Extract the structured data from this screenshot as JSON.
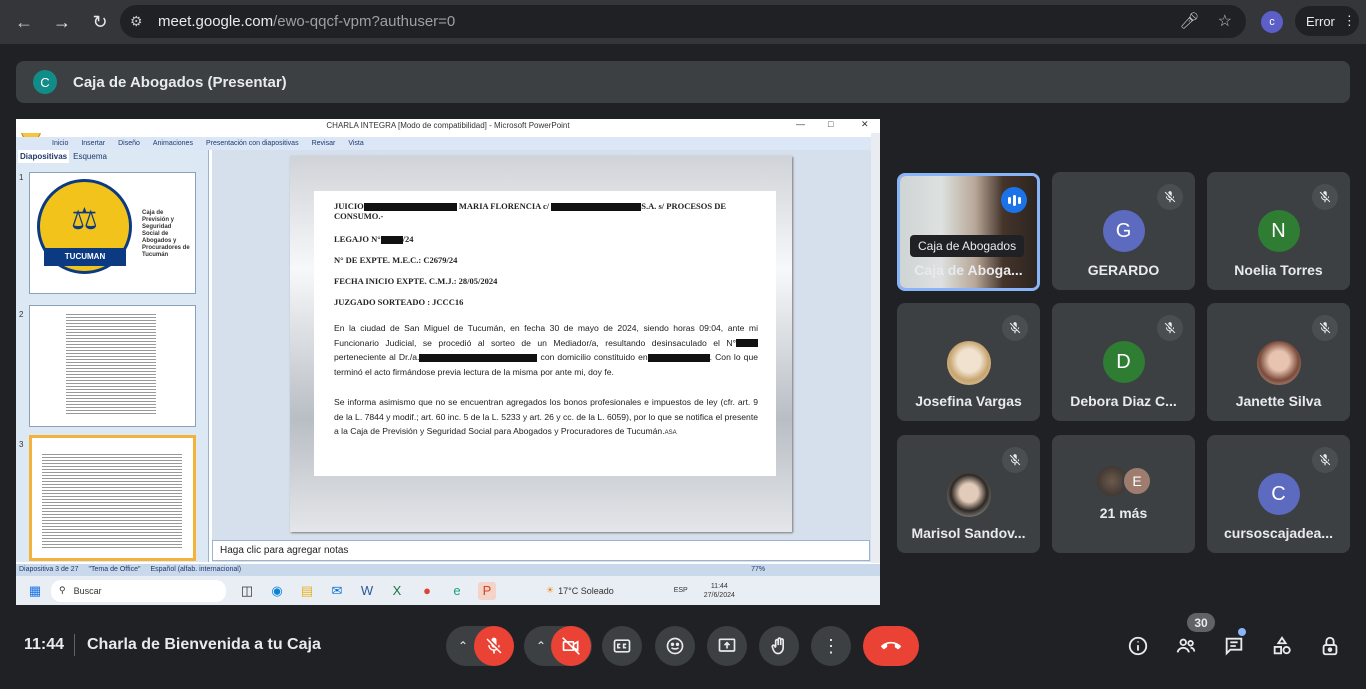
{
  "browser": {
    "url_host": "meet.google.com",
    "url_path": "/ewo-qqcf-vpm?authuser=0",
    "profile_initial": "c",
    "error_label": "Error"
  },
  "presenter": {
    "initial": "C",
    "title": "Caja de Abogados (Presentar)"
  },
  "ppt": {
    "window_title": "CHARLA INTEGRA [Modo de compatibilidad] - Microsoft PowerPoint",
    "menu": [
      "Inicio",
      "Insertar",
      "Diseño",
      "Animaciones",
      "Presentación con diapositivas",
      "Revisar",
      "Vista"
    ],
    "tabs": [
      "Diapositivas",
      "Esquema"
    ],
    "slide_numbers": [
      "1",
      "2",
      "3"
    ],
    "logo_band": "TUCUMAN",
    "logo_text": "Caja de Previsión y Seguridad Social de Abogados y Procuradores de Tucumán",
    "doc": {
      "h1a": "JUICIO",
      "h1b": "MARIA FLORENCIA c/",
      "h1c": "S.A. s/ PROCESOS DE CONSUMO.-",
      "legajo_a": "LEGAJO N°",
      "legajo_b": "/24",
      "expte": "N° DE EXPTE. M.E.C.: C2679/24",
      "fecha": "FECHA INICIO EXPTE. C.M.J.: 28/05/2024",
      "juzgado": "JUZGADO SORTEADO : JCCC16",
      "p1a": "En la ciudad de San Miguel de Tucumán, en fecha 30 de mayo de 2024, siendo horas 09:04, ante mi Funcionario Judicial, se procedió al sorteo de un Mediador/a, resultando desinsaculado el N°",
      "p1b": "perteneciente al Dr./a.",
      "p1c": "con domicilio constituido en",
      "p1d": ". Con lo que terminó el acto firmándose previa lectura de la misma por ante mi, doy fe.",
      "p2": "Se informa asimismo que no se encuentran agregados los bonos profesionales e impuestos de ley (cfr. art. 9 de la L. 7844 y modif.; art. 60 inc. 5 de la L. 5233 y art. 26 y cc. de la L. 6059), por lo que se notifica el presente a la Caja de Previsión y Seguridad Social para Abogados y Procuradores de Tucumán.",
      "p2_tail": "ASA"
    },
    "notes_placeholder": "Haga clic para agregar notas",
    "status": [
      "Diapositiva 3 de 27",
      "\"Tema de Office\"",
      "Español (alfab. internacional)"
    ],
    "zoom": "77%",
    "taskbar": {
      "search": "Buscar",
      "weather": "17°C  Soleado",
      "lang": "ESP",
      "time": "11:44",
      "date": "27/6/2024"
    }
  },
  "participants": [
    {
      "name": "Caja de Aboga...",
      "tooltip": "Caja de Abogados",
      "initial": "",
      "color": ""
    },
    {
      "name": "GERARDO",
      "initial": "G",
      "color": "#5c6bc0"
    },
    {
      "name": "Noelia Torres",
      "initial": "N",
      "color": "#2e7d32"
    },
    {
      "name": "Josefina Vargas",
      "initial": "",
      "color": "#d9c7a8"
    },
    {
      "name": "Debora Diaz C...",
      "initial": "D",
      "color": "#2e7d32"
    },
    {
      "name": "Janette Silva",
      "initial": "",
      "color": "#8a5a4a"
    },
    {
      "name": "Marisol Sandov...",
      "initial": "",
      "color": "#bfbab5"
    },
    {
      "name": "21 más",
      "initial": "E",
      "color": "#9e7d6f"
    },
    {
      "name": "cursoscajadea...",
      "initial": "C",
      "color": "#5c6bc0"
    }
  ],
  "bottom": {
    "time": "11:44",
    "meeting_title": "Charla de Bienvenida a tu Caja",
    "participant_count": "30"
  }
}
